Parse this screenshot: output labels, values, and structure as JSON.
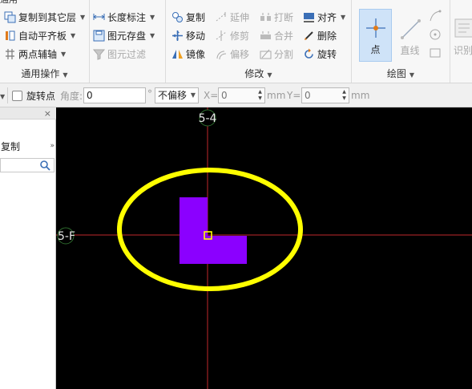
{
  "window": {
    "cut_title": "通用"
  },
  "ribbon": {
    "general_ops": {
      "label": "通用操作",
      "copy_to_layer": "复制到其它层",
      "auto_level_slab": "自动平齐板",
      "two_point_axis": "两点辅轴",
      "length_dim": "长度标注",
      "save_element": "图元存盘",
      "filter_element": "图元过滤"
    },
    "modify": {
      "label": "修改",
      "copy": "复制",
      "extend": "延伸",
      "break": "打断",
      "align": "对齐",
      "move": "移动",
      "trim": "修剪",
      "merge": "合并",
      "delete": "删除",
      "mirror": "镜像",
      "offset": "偏移",
      "split": "分割",
      "rotate": "旋转"
    },
    "draw": {
      "label": "绘图",
      "point": "点",
      "line": "直线"
    },
    "identify": {
      "label": "识别"
    }
  },
  "propbar": {
    "rotate_point": "旋转点",
    "angle_label": "角度:",
    "angle_value": "0",
    "degree_symbol": "°",
    "offset_option": "不偏移",
    "x_label": "X=",
    "x_value": "0",
    "x_unit": "mm",
    "y_label": "Y=",
    "y_value": "0",
    "y_unit": "mm"
  },
  "left_panel": {
    "close_symbol": "×",
    "copy_row": "复制",
    "more_symbol": "»"
  },
  "canvas": {
    "axis_top_label": "5-4",
    "axis_left_label": "5-F",
    "colors": {
      "background": "#000000",
      "axis_line": "#c1272d",
      "ellipse": "#ffff00",
      "shape": "#8b00ff",
      "grip": "#ffff00"
    }
  },
  "icons": [
    "copy-to-layer-icon",
    "auto-level-icon",
    "two-point-axis-icon",
    "length-dim-icon",
    "save-element-icon",
    "filter-icon",
    "copy-icon",
    "extend-icon",
    "break-icon",
    "align-icon",
    "move-icon",
    "trim-icon",
    "merge-icon",
    "delete-icon",
    "mirror-icon",
    "offset-icon",
    "split-icon",
    "rotate-icon",
    "point-icon",
    "line-icon",
    "search-icon"
  ]
}
